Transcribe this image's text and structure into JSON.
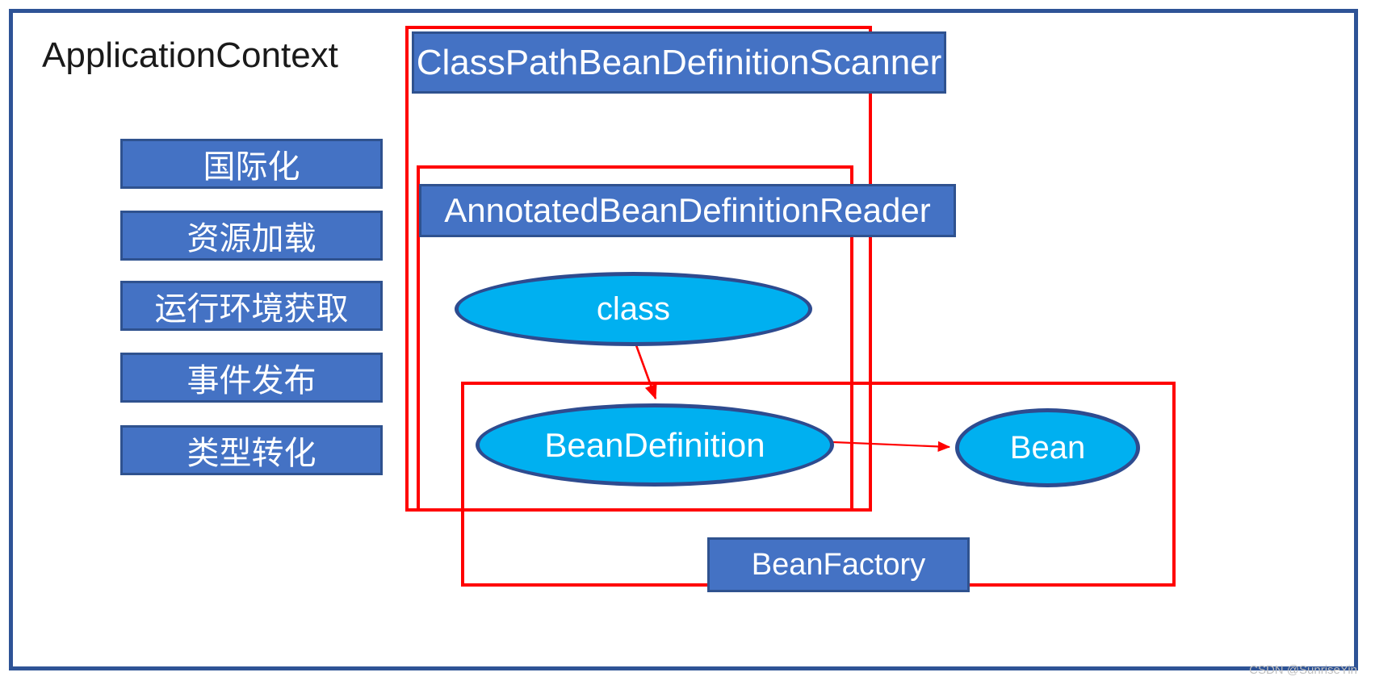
{
  "diagram": {
    "title": "ApplicationContext",
    "watermark": "CSDN @SunriseYin",
    "colors": {
      "frame_border": "#2E5396",
      "blue_box_fill": "#4472C4",
      "blue_box_border": "#2F528F",
      "ellipse_fill": "#00B0F0",
      "ellipse_border": "#2E4B8F",
      "red_group_border": "#FF0000",
      "text_on_blue": "#FFFFFF",
      "title_text": "#1A1A1A"
    }
  },
  "sidebar": {
    "items": [
      {
        "label": "国际化"
      },
      {
        "label": "资源加载"
      },
      {
        "label": "运行环境获取"
      },
      {
        "label": "事件发布"
      },
      {
        "label": "类型转化"
      }
    ]
  },
  "components": {
    "scanner": "ClassPathBeanDefinitionScanner",
    "reader": "AnnotatedBeanDefinitionReader",
    "bean_factory": "BeanFactory"
  },
  "nodes": {
    "class": "class",
    "bean_definition": "BeanDefinition",
    "bean": "Bean"
  },
  "groups": {
    "scanner_group": "ClassPathBeanDefinitionScanner",
    "reader_group": "AnnotatedBeanDefinitionReader",
    "factory_group": "BeanFactory"
  },
  "edges": [
    {
      "from": "class",
      "to": "BeanDefinition"
    },
    {
      "from": "BeanDefinition",
      "to": "Bean"
    }
  ]
}
